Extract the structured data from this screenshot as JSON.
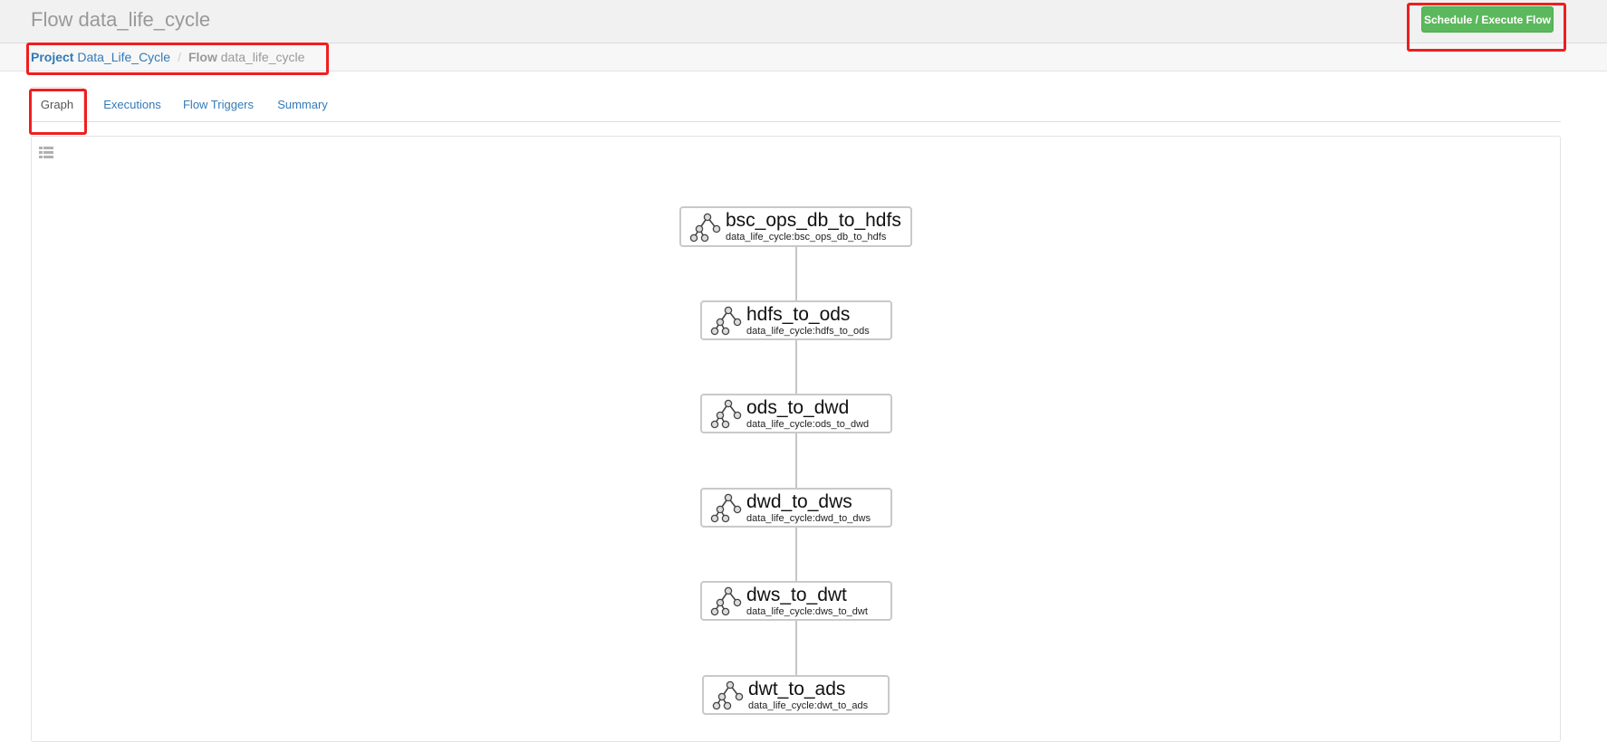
{
  "header": {
    "title": "Flow data_life_cycle",
    "execute_button": "Schedule / Execute Flow"
  },
  "breadcrumb": {
    "project_label": "Project",
    "project_name": "Data_Life_Cycle",
    "separator": "/",
    "flow_label": "Flow",
    "flow_name": "data_life_cycle"
  },
  "tabs": [
    {
      "label": "Graph",
      "active": true
    },
    {
      "label": "Executions",
      "active": false
    },
    {
      "label": "Flow Triggers",
      "active": false
    },
    {
      "label": "Summary",
      "active": false
    }
  ],
  "graph": {
    "list_toggle_icon": "list-icon",
    "node_icon": "flow-tree-icon",
    "nodes": [
      {
        "name": "bsc_ops_db_to_hdfs",
        "subtitle": "data_life_cycle:bsc_ops_db_to_hdfs"
      },
      {
        "name": "hdfs_to_ods",
        "subtitle": "data_life_cycle:hdfs_to_ods"
      },
      {
        "name": "ods_to_dwd",
        "subtitle": "data_life_cycle:ods_to_dwd"
      },
      {
        "name": "dwd_to_dws",
        "subtitle": "data_life_cycle:dwd_to_dws"
      },
      {
        "name": "dws_to_dwt",
        "subtitle": "data_life_cycle:dws_to_dwt"
      },
      {
        "name": "dwt_to_ads",
        "subtitle": "data_life_cycle:dwt_to_ads"
      }
    ],
    "edges": [
      [
        0,
        1
      ],
      [
        1,
        2
      ],
      [
        2,
        3
      ],
      [
        3,
        4
      ],
      [
        4,
        5
      ]
    ]
  },
  "colors": {
    "execute_button": "#5cb85c",
    "link": "#337ab7",
    "highlight": "#f01e1e"
  }
}
